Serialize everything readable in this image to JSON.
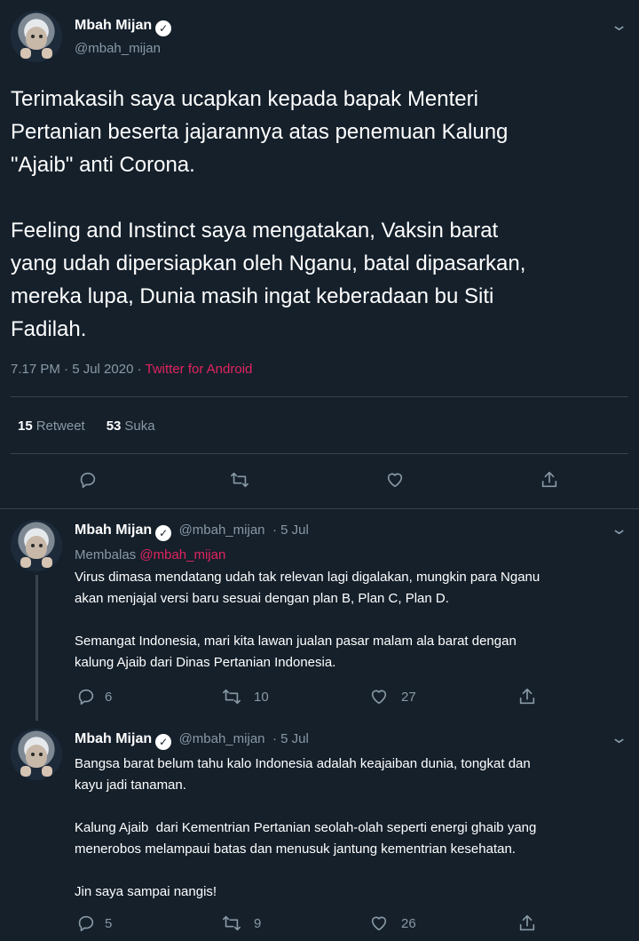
{
  "main_tweet": {
    "author_name": "Mbah Mijan",
    "author_handle": "@mbah_mijan",
    "text": "Terimakasih saya ucapkan kepada bapak Menteri\nPertanian beserta jajarannya atas penemuan Kalung\n\"Ajaib\" anti Corona.\n\nFeeling and Instinct saya mengatakan, Vaksin barat\nyang udah dipersiapkan oleh Nganu, batal dipasarkan,\nmereka lupa, Dunia masih ingat keberadaan bu Siti\nFadilah.",
    "timestamp": "7.17 PM · 5 Jul 2020",
    "separator": " · ",
    "source": "Twitter for Android",
    "retweets": "15",
    "retweets_label": "Retweet",
    "likes": "53",
    "likes_label": "Suka"
  },
  "replies": [
    {
      "author_name": "Mbah Mijan",
      "author_handle": "@mbah_mijan",
      "date": "· 5 Jul",
      "replying_prefix": "Membalas",
      "replying_to": "@mbah_mijan",
      "text": "Virus dimasa mendatang udah tak relevan lagi digalakan, mungkin para Nganu\nakan menjajal versi baru sesuai dengan plan B, Plan C, Plan D.\n\nSemangat Indonesia, mari kita lawan jualan pasar malam ala barat dengan\nkalung Ajaib dari Dinas Pertanian Indonesia.",
      "replies_count": "6",
      "retweets_count": "10",
      "likes_count": "27"
    },
    {
      "author_name": "Mbah Mijan",
      "author_handle": "@mbah_mijan",
      "date": "· 5 Jul",
      "text": "Bangsa barat belum tahu kalo Indonesia adalah keajaiban dunia, tongkat dan\nkayu jadi tanaman.\n\nKalung Ajaib  dari Kementrian Pertanian seolah-olah seperti energi ghaib yang\nmenerobos melampaui batas dan menusuk jantung kementrian kesehatan.\n\nJin saya sampai nangis!",
      "replies_count": "5",
      "retweets_count": "9",
      "likes_count": "26"
    }
  ],
  "icons": {
    "verified": "verified-badge-icon",
    "reply": "reply-icon",
    "retweet": "retweet-icon",
    "like": "heart-icon",
    "share": "share-icon",
    "more": "chevron-down-icon"
  },
  "colors": {
    "background": "#15202b",
    "secondary_text": "#8899a6",
    "accent": "#e0245e",
    "divider": "#38444d"
  }
}
